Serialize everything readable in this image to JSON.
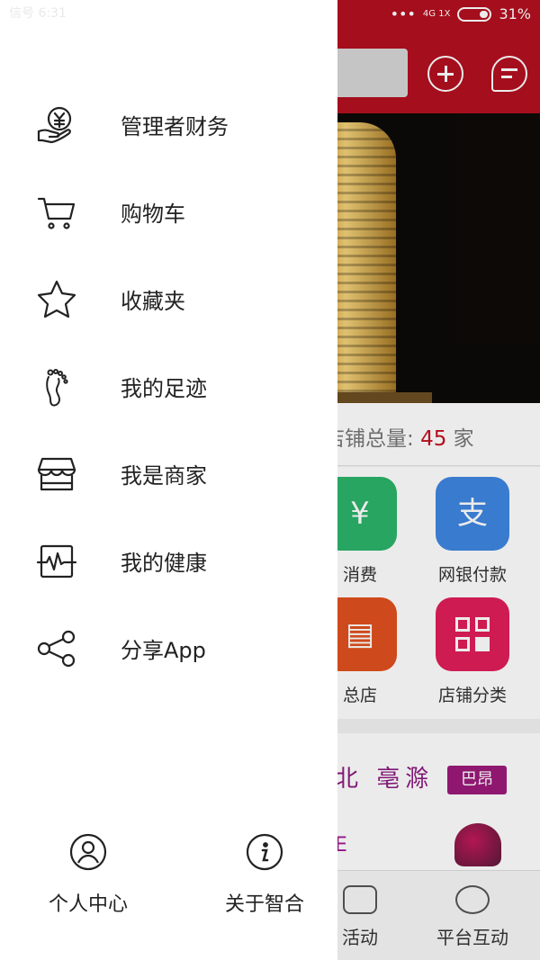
{
  "status_bar": {
    "carrier_time": "信号 6:31",
    "signal_labels": "4G 1X",
    "battery": "31%"
  },
  "home": {
    "store_count": {
      "label": "店铺总量:",
      "value": "45",
      "unit": "家"
    },
    "grid": [
      {
        "label": "消费"
      },
      {
        "label": "网银付款"
      },
      {
        "label": "总店"
      },
      {
        "label": "店铺分类"
      }
    ],
    "brands": {
      "b1": "北 亳滁",
      "b2": "巴昂",
      "b3": "E"
    },
    "tabs": [
      {
        "label": "活动"
      },
      {
        "label": "平台互动"
      }
    ]
  },
  "drawer": {
    "menu": [
      {
        "label": "管理者财务",
        "icon": "finance-hand-icon"
      },
      {
        "label": "购物车",
        "icon": "shopping-cart-icon"
      },
      {
        "label": "收藏夹",
        "icon": "star-icon"
      },
      {
        "label": "我的足迹",
        "icon": "footprint-icon"
      },
      {
        "label": "我是商家",
        "icon": "storefront-icon"
      },
      {
        "label": "我的健康",
        "icon": "health-monitor-icon"
      },
      {
        "label": "分享App",
        "icon": "share-icon"
      }
    ],
    "footer": {
      "profile_label": "个人中心",
      "about_label": "关于智合"
    }
  },
  "colors": {
    "brand_red": "#b3101f",
    "count_red": "#c2101f"
  }
}
